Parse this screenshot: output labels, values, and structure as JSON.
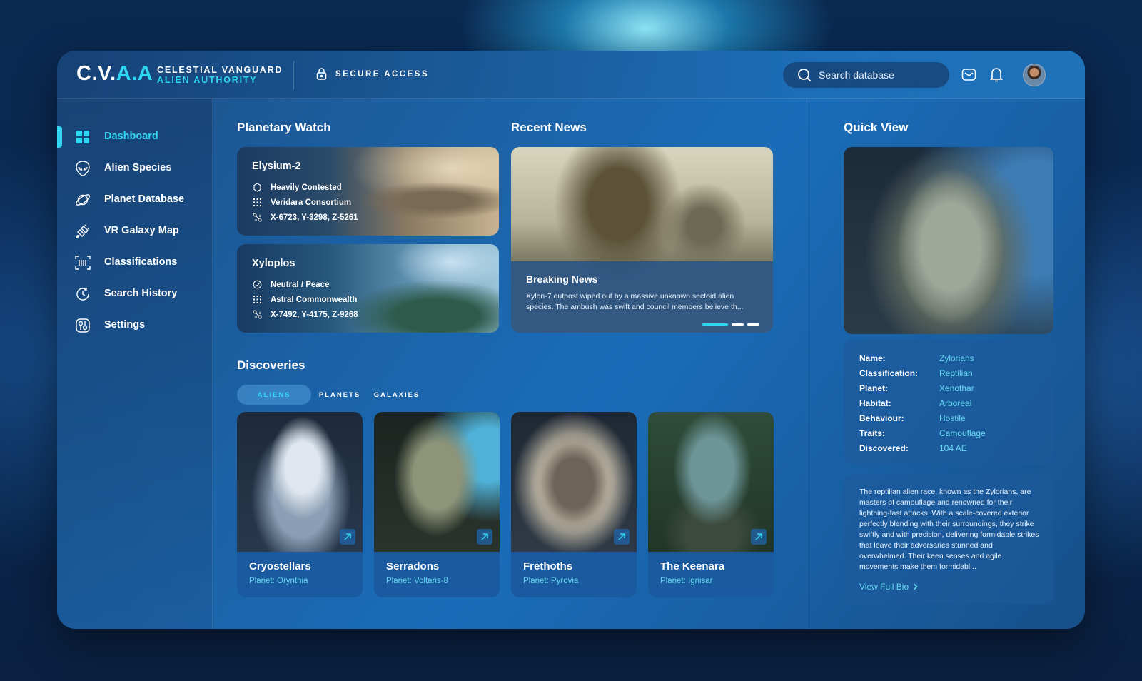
{
  "header": {
    "logo_main": "C.V.",
    "logo_accent": "A.A",
    "brand_line1": "CELESTIAL VANGUARD",
    "brand_line2": "ALIEN AUTHORITY",
    "secure_label": "SECURE ACCESS",
    "search_placeholder": "Search database"
  },
  "sidebar": {
    "items": [
      {
        "label": "Dashboard",
        "icon": "dashboard-grid-icon",
        "active": true
      },
      {
        "label": "Alien Species",
        "icon": "alien-head-icon"
      },
      {
        "label": "Planet Database",
        "icon": "planet-ring-icon"
      },
      {
        "label": "VR Galaxy Map",
        "icon": "satellite-icon"
      },
      {
        "label": "Classifications",
        "icon": "barcode-scan-icon"
      },
      {
        "label": "Search History",
        "icon": "history-icon"
      },
      {
        "label": "Settings",
        "icon": "settings-icon"
      }
    ]
  },
  "planetary_watch": {
    "title": "Planetary Watch",
    "planets": [
      {
        "name": "Elysium-2",
        "status": "Heavily Contested",
        "faction": "Veridara Consortium",
        "coords": "X-6723, Y-3298, Z-5261"
      },
      {
        "name": "Xyloplos",
        "status": "Neutral / Peace",
        "faction": "Astral Commonwealth",
        "coords": "X-7492, Y-4175, Z-9268"
      }
    ]
  },
  "recent_news": {
    "title": "Recent News",
    "headline": "Breaking News",
    "body": "Xylon-7 outpost wiped out by a massive unknown sectoid alien species. The ambush was swift and council members believe th..."
  },
  "discoveries": {
    "title": "Discoveries",
    "tabs": [
      "ALIENS",
      "PLANETS",
      "GALAXIES"
    ],
    "active_tab": "ALIENS",
    "cards": [
      {
        "name": "Cryostellars",
        "planet": "Planet: Orynthia"
      },
      {
        "name": "Serradons",
        "planet": "Planet: Voltaris-8"
      },
      {
        "name": "Frethoths",
        "planet": "Planet: Pyrovia"
      },
      {
        "name": "The Keenara",
        "planet": "Planet: Ignisar"
      }
    ]
  },
  "quick_view": {
    "title": "Quick View",
    "fields": [
      {
        "key": "Name:",
        "value": "Zylorians"
      },
      {
        "key": "Classification:",
        "value": "Reptilian"
      },
      {
        "key": "Planet:",
        "value": "Xenothar"
      },
      {
        "key": "Habitat:",
        "value": "Arboreal"
      },
      {
        "key": "Behaviour:",
        "value": "Hostile"
      },
      {
        "key": "Traits:",
        "value": "Camouflage"
      },
      {
        "key": "Discovered:",
        "value": "104 AE"
      }
    ],
    "bio": "The reptilian alien race, known as the Zylorians, are masters of camouflage and renowned for their lightning-fast attacks. With a scale-covered exterior perfectly blending with their surroundings, they strike swiftly and with precision, delivering formidable strikes that leave their adversaries stunned and overwhelmed. Their keen senses and agile movements make them formidabl...",
    "link": "View Full Bio"
  },
  "colors": {
    "accent": "#2fd6f2",
    "link": "#66d9f0",
    "panel": "#1b63a8"
  }
}
